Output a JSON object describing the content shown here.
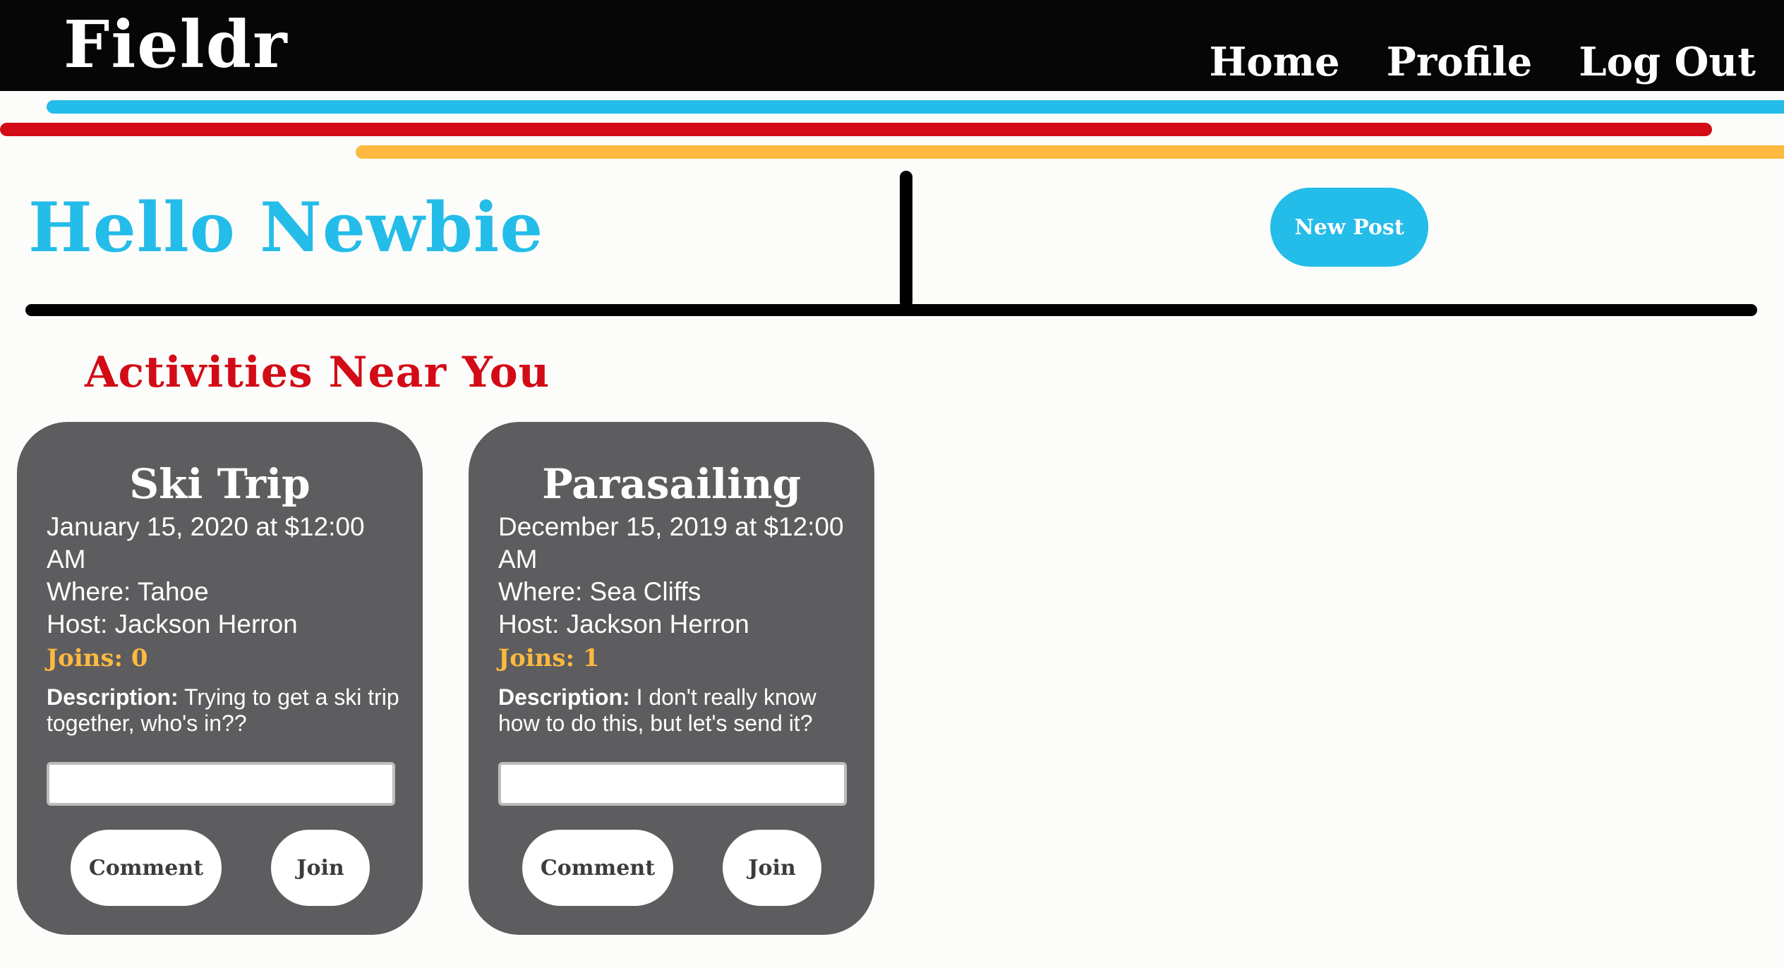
{
  "colors": {
    "nav_background": "#060606",
    "accent_blue": "#24bce9",
    "accent_red": "#d20b16",
    "accent_yellow": "#fdb940",
    "card_background": "#5d5c5e"
  },
  "header": {
    "logo": "Fieldr",
    "nav": [
      "Home",
      "Profile",
      "Log Out"
    ]
  },
  "greeting": "Hello Newbie",
  "new_post_label": "New Post",
  "section_title": "Activities Near You",
  "activities": [
    {
      "title": "Ski Trip",
      "date_line": "January 15, 2020 at $12:00 AM",
      "where": "Where: Tahoe",
      "host": "Host: Jackson Herron",
      "joins": "Joins: 0",
      "description_label": "Description:",
      "description": "Trying to get a ski trip together, who's in??",
      "comment_placeholder": "",
      "comment_label": "Comment",
      "join_label": "Join"
    },
    {
      "title": "Parasailing",
      "date_line": "December 15, 2019 at $12:00 AM",
      "where": "Where: Sea Cliffs",
      "host": "Host: Jackson Herron",
      "joins": "Joins: 1",
      "description_label": "Description:",
      "description": "I don't really know how to do this, but let's send it?",
      "comment_placeholder": "",
      "comment_label": "Comment",
      "join_label": "Join"
    }
  ]
}
